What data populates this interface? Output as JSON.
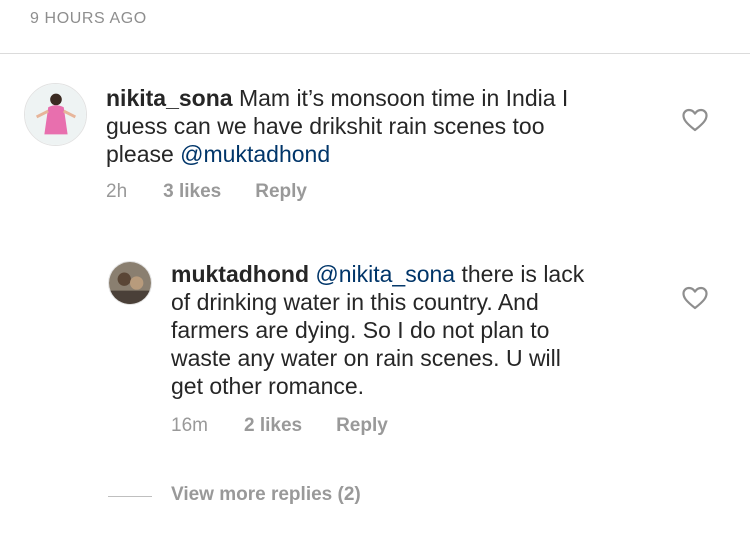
{
  "header": {
    "timestamp": "9 HOURS AGO"
  },
  "comment": {
    "username": "nikita_sona",
    "text_line1": "Mam it’s monsoon time in India I",
    "text_line2": "guess can we have drikshit rain scenes too",
    "text_line3": "please ",
    "mention": "@muktadhond",
    "time": "2h",
    "likes": "3 likes",
    "reply_label": "Reply",
    "avatar_icon": "avatar-photo"
  },
  "reply": {
    "username": "muktadhond",
    "mention": "@nikita_sona",
    "text_line1_rest": " there is lack",
    "text_line2": "of drinking water in this country. And",
    "text_line3": "farmers are dying. So I do not plan to",
    "text_line4": "waste any water on rain scenes. U will",
    "text_line5": "get other romance.",
    "time": "16m",
    "likes": "2 likes",
    "reply_label": "Reply",
    "avatar_icon": "avatar-photo"
  },
  "view_more": {
    "label": "View more replies (2)"
  },
  "icons": {
    "like": "heart-outline-icon"
  },
  "colors": {
    "mention": "#003569",
    "meta": "#999999",
    "timestamp": "#8e8e8e"
  }
}
